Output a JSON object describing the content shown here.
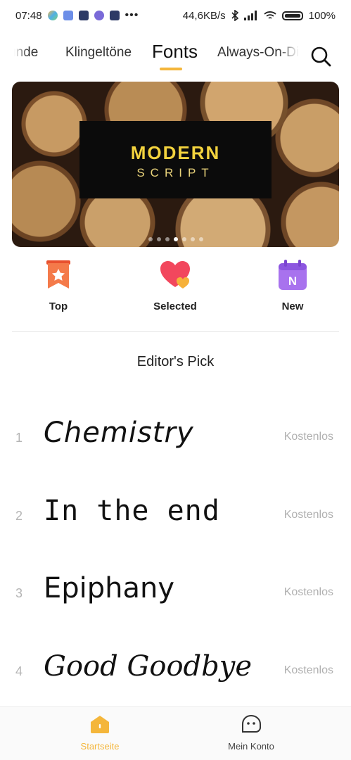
{
  "status_bar": {
    "time": "07:48",
    "network_speed": "44,6KB/s",
    "battery": "100"
  },
  "tabs": [
    {
      "label": "ünde"
    },
    {
      "label": "Klingeltöne"
    },
    {
      "label": "Fonts",
      "active": true
    },
    {
      "label": "Always-On-Di"
    }
  ],
  "banner": {
    "title": "MODERN",
    "subtitle": "SCRIPT",
    "slides": 7,
    "active_slide": 4
  },
  "categories": [
    {
      "label": "Top",
      "icon": "bookmark-star-icon"
    },
    {
      "label": "Selected",
      "icon": "hearts-icon"
    },
    {
      "label": "New",
      "icon": "calendar-n-icon"
    }
  ],
  "section": {
    "title": "Editor's Pick"
  },
  "fonts": [
    {
      "rank": "1",
      "name": "Chemistry",
      "price": "Kostenlos"
    },
    {
      "rank": "2",
      "name": "In the end",
      "price": "Kostenlos"
    },
    {
      "rank": "3",
      "name": "Epiphany",
      "price": "Kostenlos"
    },
    {
      "rank": "4",
      "name": "Good Goodbye",
      "price": "Kostenlos"
    }
  ],
  "bottom_nav": [
    {
      "label": "Startseite",
      "icon": "home-icon",
      "active": true
    },
    {
      "label": "Mein Konto",
      "icon": "account-face-icon",
      "active": false
    }
  ],
  "colors": {
    "accent": "#f4b63b",
    "banner_title": "#f3d33e"
  }
}
